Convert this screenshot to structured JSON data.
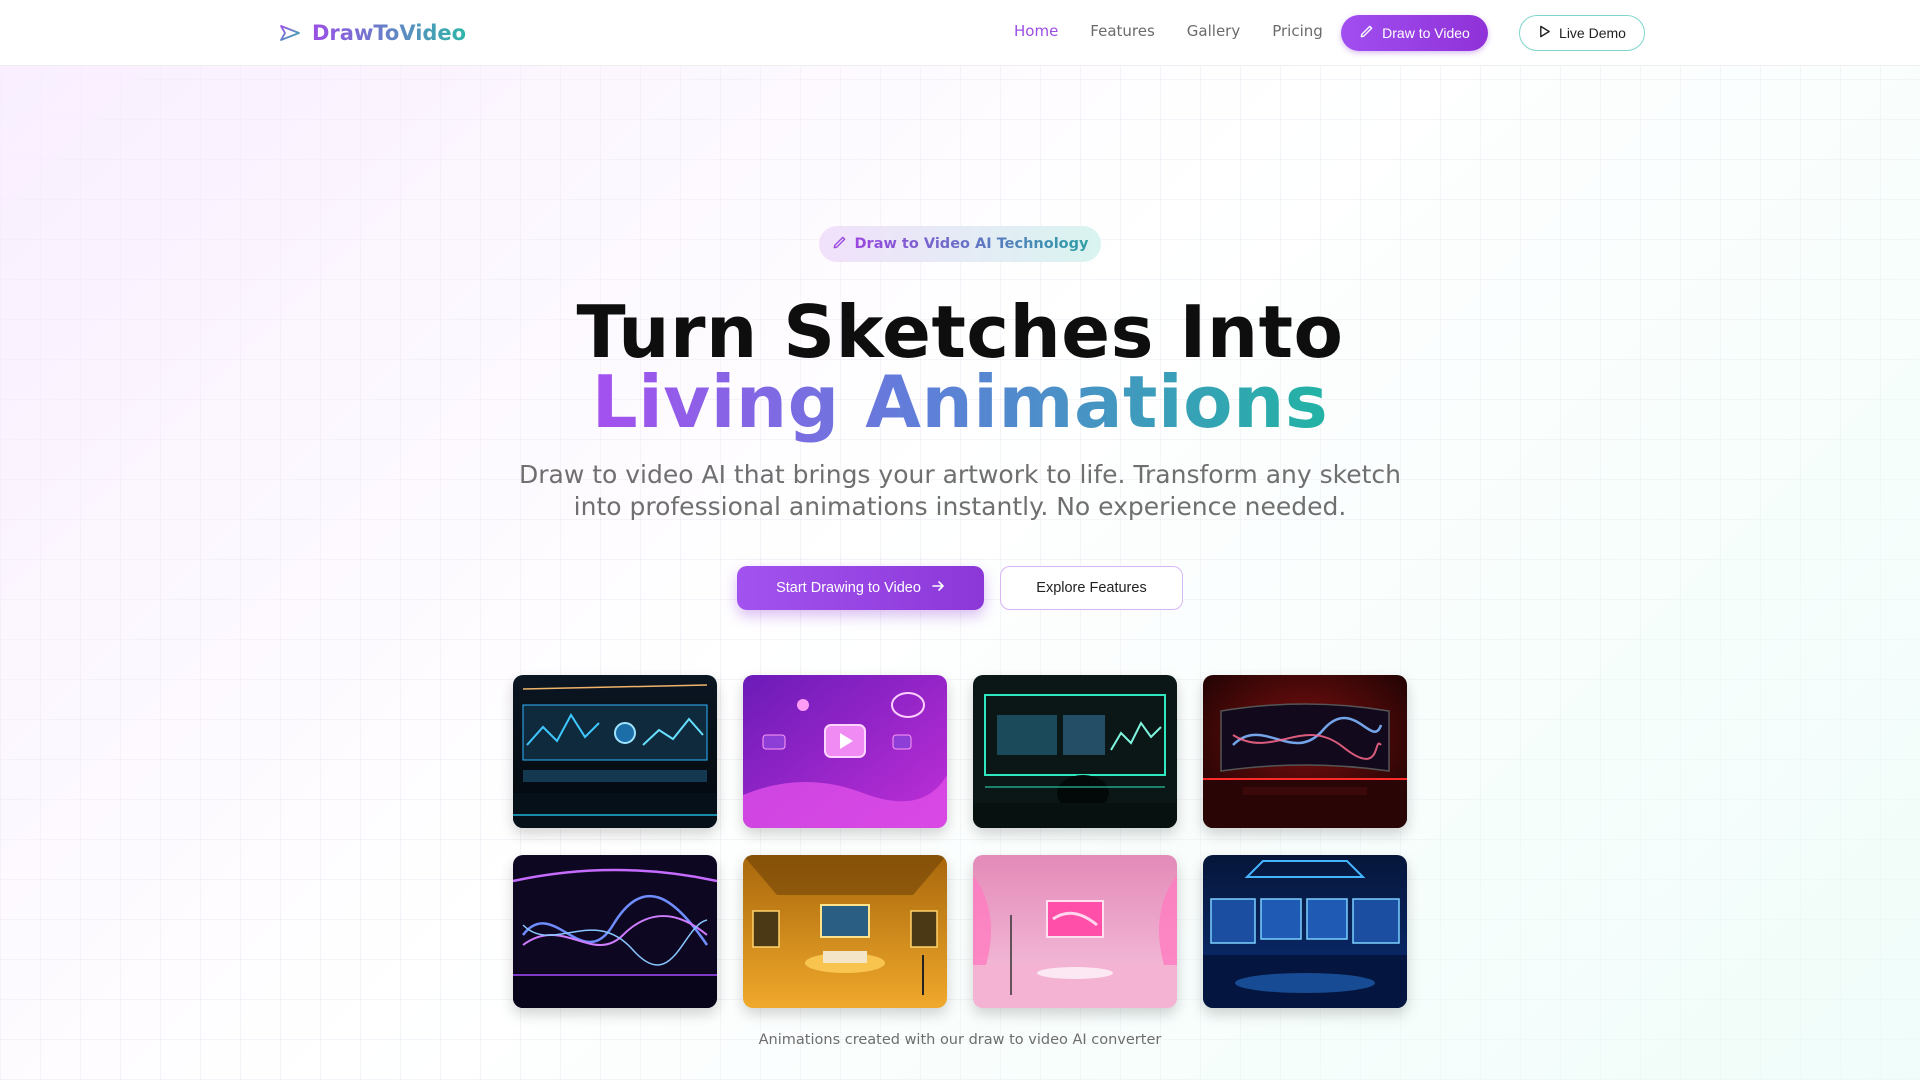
{
  "brand": {
    "name": "DrawToVideo",
    "icon": "paper-plane-icon"
  },
  "nav": {
    "links": [
      {
        "label": "Home",
        "active": true
      },
      {
        "label": "Features",
        "active": false
      },
      {
        "label": "Gallery",
        "active": false
      },
      {
        "label": "Pricing",
        "active": false
      }
    ],
    "cta_label": "Draw to Video",
    "cta_icon": "pencil-icon",
    "demo_label": "Live Demo",
    "demo_icon": "play-icon"
  },
  "hero": {
    "badge": "Draw to Video AI Technology",
    "title_line1": "Turn Sketches Into",
    "title_line2": "Living Animations",
    "subtitle": "Draw to video AI that brings your artwork to life. Transform any sketch into professional animations instantly. No experience needed.",
    "primary_button": "Start Drawing to Video",
    "secondary_button": "Explore Features",
    "caption": "Animations created with our draw to video AI converter"
  },
  "colors": {
    "accent_purple": "#9c4ee3",
    "accent_teal": "#2eb5a8",
    "text_dark": "#0e0e0e",
    "text_muted": "#6f6f6f"
  }
}
